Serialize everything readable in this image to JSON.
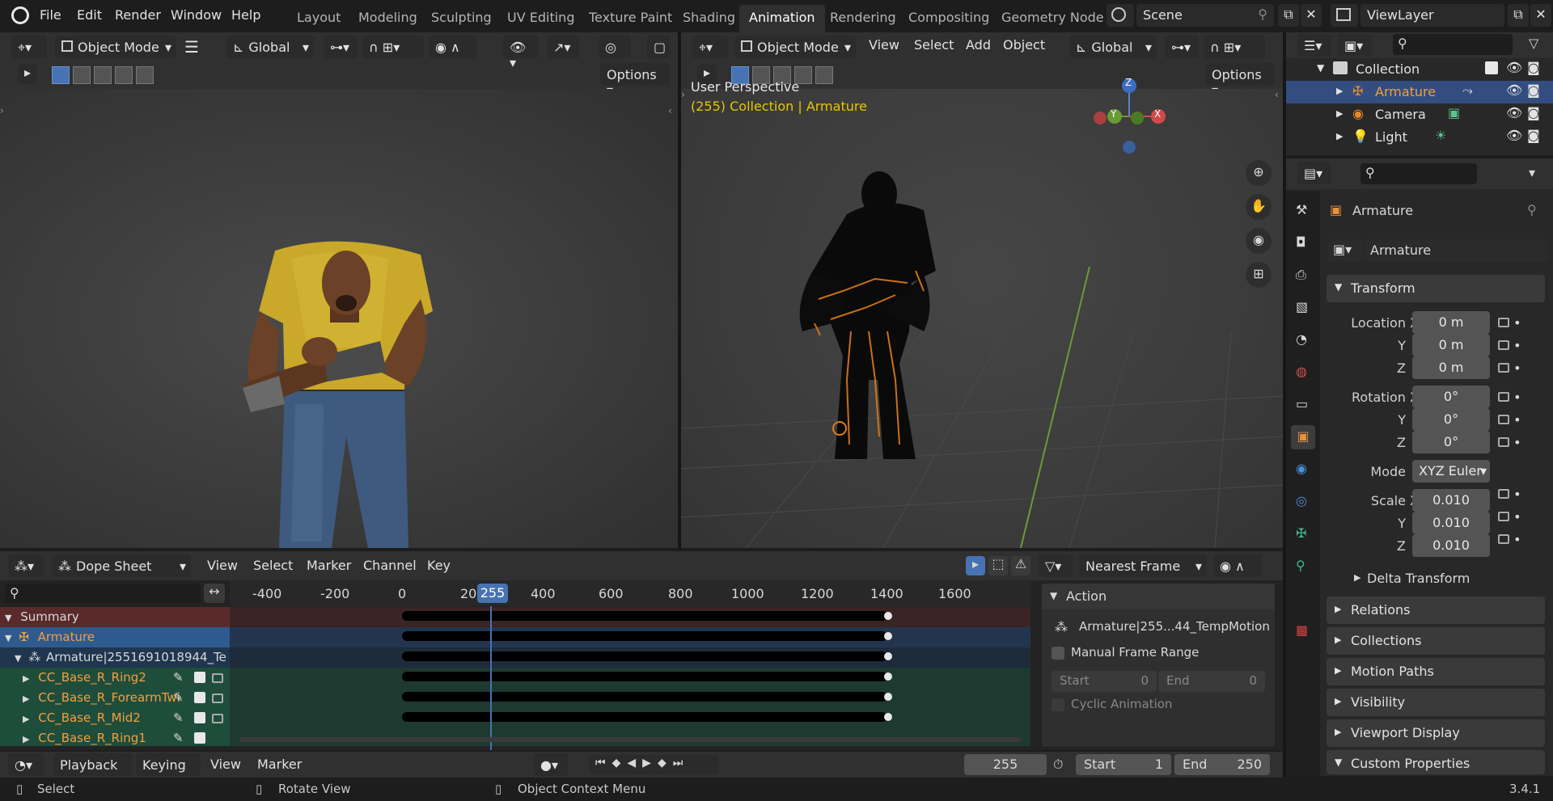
{
  "topbar": {
    "menus": [
      "File",
      "Edit",
      "Render",
      "Window",
      "Help"
    ],
    "workspaces": [
      "Layout",
      "Modeling",
      "Sculpting",
      "UV Editing",
      "Texture Paint",
      "Shading",
      "Animation",
      "Rendering",
      "Compositing",
      "Geometry Node"
    ],
    "active_workspace": "Animation",
    "scene": "Scene",
    "view_layer": "ViewLayer"
  },
  "viewport_left": {
    "mode": "Object Mode",
    "orientation": "Global",
    "options": "Options"
  },
  "viewport_right": {
    "mode": "Object Mode",
    "menus": [
      "View",
      "Select",
      "Add",
      "Object"
    ],
    "orientation": "Global",
    "options": "Options",
    "view_name": "User Perspective",
    "context": "(255) Collection | Armature",
    "gizmo": {
      "z": "Z",
      "x": "X",
      "y": "Y"
    }
  },
  "outliner": {
    "collection": "Collection",
    "items": [
      "Armature",
      "Camera",
      "Light"
    ]
  },
  "properties": {
    "object_name": "Armature",
    "data_name": "Armature",
    "transform_label": "Transform",
    "location": {
      "label": "Location X",
      "x": "0 m",
      "y": "0 m",
      "z": "0 m"
    },
    "rotation": {
      "label": "Rotation X",
      "x": "0°",
      "y": "0°",
      "z": "0°"
    },
    "mode_label": "Mode",
    "mode_value": "XYZ Euler",
    "scale": {
      "label": "Scale X",
      "x": "0.010",
      "y": "0.010",
      "z": "0.010"
    },
    "axis_y": "Y",
    "axis_z": "Z",
    "panels": [
      "Delta Transform",
      "Relations",
      "Collections",
      "Motion Paths",
      "Visibility",
      "Viewport Display",
      "Custom Properties"
    ]
  },
  "dopesheet": {
    "editor": "Dope Sheet",
    "menus": [
      "View",
      "Select",
      "Marker",
      "Channel",
      "Key"
    ],
    "snap": "Nearest Frame",
    "ruler": [
      "-400",
      "-200",
      "0",
      "20",
      "400",
      "600",
      "800",
      "1000",
      "1200",
      "1400",
      "1600"
    ],
    "current_frame": "255",
    "channels": [
      "Summary",
      "Armature",
      "Armature|2551691018944_Te",
      "CC_Base_R_Ring2",
      "CC_Base_R_ForearmTwi",
      "CC_Base_R_Mid2",
      "CC_Base_R_Ring1"
    ],
    "action_panel": {
      "title": "Action",
      "action_name": "Armature|255...44_TempMotion",
      "manual_range": "Manual Frame Range",
      "start_label": "Start",
      "start_value": "0",
      "end_label": "End",
      "end_value": "0",
      "cyclic": "Cyclic Animation"
    }
  },
  "timeline": {
    "menus": [
      "Playback",
      "Keying",
      "View",
      "Marker"
    ],
    "frame": "255",
    "start_label": "Start",
    "start_value": "1",
    "end_label": "End",
    "end_value": "250"
  },
  "statusbar": {
    "select": "Select",
    "rotate": "Rotate View",
    "context_menu": "Object Context Menu",
    "version": "3.4.1"
  }
}
